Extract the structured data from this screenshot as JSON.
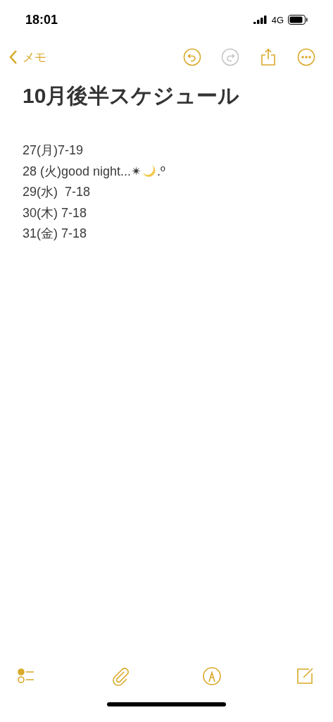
{
  "status_bar": {
    "time": "18:01",
    "network": "4G"
  },
  "nav": {
    "back_label": "メモ",
    "buttons": [
      {
        "kind": "undo",
        "disabled": false
      },
      {
        "kind": "redo",
        "disabled": true
      },
      {
        "kind": "share",
        "disabled": false
      },
      {
        "kind": "more",
        "disabled": false
      }
    ]
  },
  "note": {
    "title": "10月後半スケジュール",
    "lines": [
      [
        {
          "kind": "text",
          "text": "27(月)7-19"
        }
      ],
      [
        {
          "kind": "text",
          "text": "28 (火)good night...✴"
        },
        {
          "kind": "moon"
        },
        {
          "kind": "text",
          "text": ".º"
        }
      ],
      [
        {
          "kind": "text",
          "text": "29(水)  7-18"
        }
      ],
      [
        {
          "kind": "text",
          "text": "30(木) 7-18"
        }
      ],
      [
        {
          "kind": "text",
          "text": "31(金) 7-18"
        }
      ]
    ]
  },
  "toolbar": [
    {
      "kind": "checklist"
    },
    {
      "kind": "attach"
    },
    {
      "kind": "markup"
    },
    {
      "kind": "compose"
    }
  ]
}
